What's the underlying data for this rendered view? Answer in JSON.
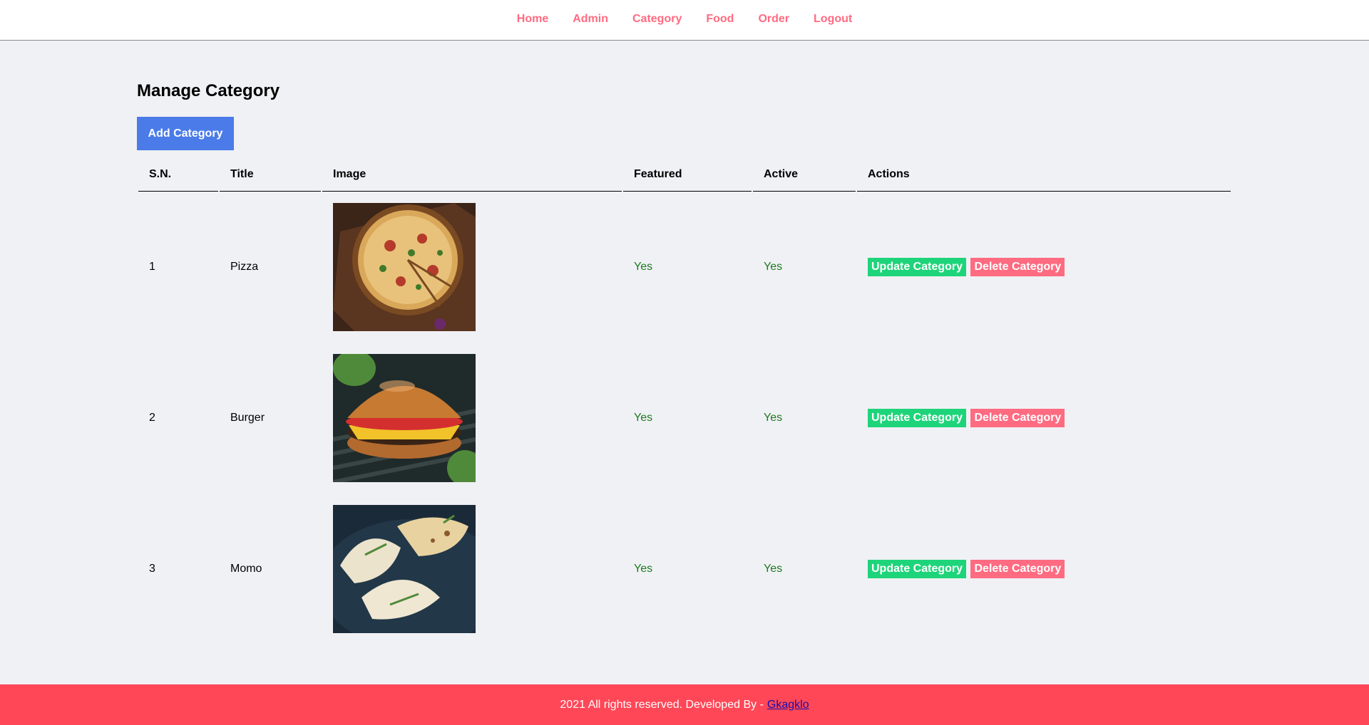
{
  "nav": {
    "items": [
      {
        "label": "Home"
      },
      {
        "label": "Admin"
      },
      {
        "label": "Category"
      },
      {
        "label": "Food"
      },
      {
        "label": "Order"
      },
      {
        "label": "Logout"
      }
    ]
  },
  "main": {
    "title": "Manage Category",
    "add_button": "Add Category",
    "table": {
      "headers": [
        "S.N.",
        "Title",
        "Image",
        "Featured",
        "Active",
        "Actions"
      ],
      "rows": [
        {
          "sn": "1",
          "title": "Pizza",
          "image": "pizza-image",
          "featured": "Yes",
          "active": "Yes",
          "update": "Update Category",
          "delete": "Delete Category"
        },
        {
          "sn": "2",
          "title": "Burger",
          "image": "burger-image",
          "featured": "Yes",
          "active": "Yes",
          "update": "Update Category",
          "delete": "Delete Category"
        },
        {
          "sn": "3",
          "title": "Momo",
          "image": "momo-image",
          "featured": "Yes",
          "active": "Yes",
          "update": "Update Category",
          "delete": "Delete Category"
        }
      ]
    }
  },
  "footer": {
    "text": "2021 All rights reserved. Developed By -",
    "link": "Gkagklo"
  },
  "colors": {
    "nav_link": "#ff6b81",
    "add_button": "#4a7be8",
    "update_button": "#1ed47a",
    "delete_button": "#ff6b81",
    "footer": "#ff4757",
    "yes_text": "#1c7a1c"
  }
}
